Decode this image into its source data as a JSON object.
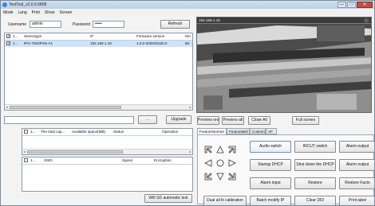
{
  "window": {
    "title": "TestTool_v2.0.5.6808",
    "minimize": "—",
    "maximize": "□",
    "close": "✕"
  },
  "menu": [
    "Mode",
    "Lang",
    "Print",
    "Show",
    "Screen"
  ],
  "login": {
    "username_label": "Username",
    "username_value": "admin",
    "password_label": "Password",
    "password_value": "•••••",
    "refresh_label": "Refresh"
  },
  "devices": {
    "columns": [
      "1...",
      "Stereotype",
      "IP",
      "Firmware version",
      "MA"
    ],
    "rows": [
      {
        "index": "1...",
        "checked": true,
        "stereotype": "IPG-7920PSS-A1",
        "ip": "192.168.1.18",
        "firmware": "1.0.0-20200316CS",
        "mac": "80-"
      }
    ]
  },
  "upgrade": {
    "path_value": "",
    "browse_label": "...",
    "upgrade_label": "Upgrade"
  },
  "storage": {
    "columns": [
      "1...",
      "The total cap...",
      "Available space(MB)",
      "Status",
      "Operation"
    ]
  },
  "wifi": {
    "columns": [
      "1...",
      "SSID",
      "Signal",
      "Encryption"
    ],
    "test_label": "Wifi SD automatic test"
  },
  "video": {
    "header_text": "192.168.1.18",
    "close_icon": "ⓧ"
  },
  "preview": {
    "preview_one": "Preview one",
    "preview_all": "Preview all",
    "close_all": "Close All",
    "full_screen": "Full screen"
  },
  "tabs": [
    "FeatureNormal",
    "FeatureBell",
    "Custom",
    "AF"
  ],
  "actions": [
    [
      "Audio switch",
      "IRCUT switch",
      "Alarm output"
    ],
    [
      "Startup DHCP",
      "Shut down the DHCP",
      "Alarm output"
    ],
    [
      "Alarm input",
      "Restore",
      "Restore Facto"
    ],
    [
      "Dual all lit calibration",
      "Batch modify IP",
      "Clear DID",
      "Print label"
    ]
  ],
  "icons": {
    "ptz_up_left": "⇖",
    "ptz_up": "△",
    "ptz_up_right": "⇗",
    "ptz_left": "◁",
    "ptz_center": "○",
    "ptz_right": "▷",
    "ptz_down_left": "⇙",
    "ptz_down": "▽",
    "ptz_down_right": "⇘"
  }
}
